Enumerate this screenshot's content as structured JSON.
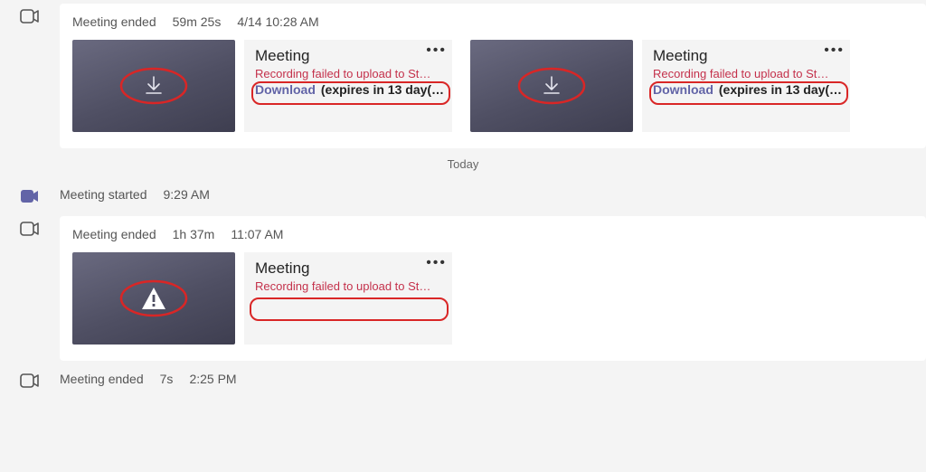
{
  "events": [
    {
      "status": "Meeting ended",
      "duration": "59m 25s",
      "time": "4/14 10:28 AM",
      "icon": "camera-outline",
      "recordings": [
        {
          "title": "Meeting",
          "fail": "Recording failed to upload to St…",
          "download": "Download",
          "expires": "(expires in 13 day(…",
          "thumbIcon": "download"
        },
        {
          "title": "Meeting",
          "fail": "Recording failed to upload to St…",
          "download": "Download",
          "expires": "(expires in 13 day(…",
          "thumbIcon": "download"
        }
      ]
    }
  ],
  "divider": "Today",
  "events2": [
    {
      "status": "Meeting started",
      "time": "9:29 AM",
      "icon": "camera-filled"
    },
    {
      "status": "Meeting ended",
      "duration": "1h 37m",
      "time": "11:07 AM",
      "icon": "camera-outline",
      "recordings": [
        {
          "title": "Meeting",
          "fail": "Recording failed to upload to St…",
          "thumbIcon": "warning"
        }
      ]
    },
    {
      "status": "Meeting ended",
      "duration": "7s",
      "time": "2:25 PM",
      "icon": "camera-outline"
    }
  ]
}
